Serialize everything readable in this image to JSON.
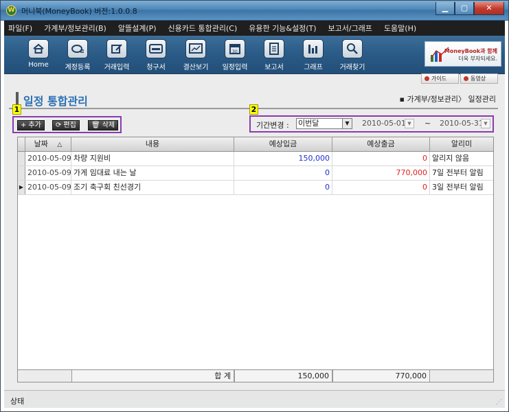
{
  "window": {
    "title": "머니북(MoneyBook) 버전:1.0.0.8",
    "app_icon_letter": "W",
    "controls": [
      "▁",
      "▢",
      "✕"
    ]
  },
  "menu": [
    "파일(F)",
    "가계부/정보관리(B)",
    "알뜰설계(P)",
    "신용카드 통합관리(C)",
    "유용한 기능&설정(T)",
    "보고서/그래프",
    "도움말(H)"
  ],
  "toolbar": [
    {
      "label": "Home",
      "icon": "home-icon"
    },
    {
      "label": "계정등록",
      "icon": "account-register-icon"
    },
    {
      "label": "거래입력",
      "icon": "transaction-edit-icon"
    },
    {
      "label": "청구서",
      "icon": "card-bill-icon"
    },
    {
      "label": "결산보기",
      "icon": "settlement-icon"
    },
    {
      "label": "일정입력",
      "icon": "calendar-icon"
    },
    {
      "label": "보고서",
      "icon": "report-icon"
    },
    {
      "label": "그래프",
      "icon": "bar-chart-icon"
    },
    {
      "label": "거래찾기",
      "icon": "search-icon"
    }
  ],
  "promo": {
    "line1": "MoneyBook과 함께",
    "line2": "더욱 부자되세요."
  },
  "help_buttons": {
    "guide": "가이드",
    "video": "동영상"
  },
  "page": {
    "title": "일정 통합관리",
    "breadcrumb": "▪ 가계부/정보관리〉 일정관리"
  },
  "markers": {
    "one": "1",
    "two": "2"
  },
  "actions": {
    "add": "추가",
    "edit": "편집",
    "delete": "삭제"
  },
  "period": {
    "label": "기간변경 :",
    "selected": "이번달",
    "start": "2010-05-01",
    "tilde": "~",
    "end": "2010-05-31"
  },
  "grid": {
    "columns": [
      "날짜",
      "내용",
      "예상입금",
      "예상출금",
      "알리미"
    ],
    "sort_indicator": "△",
    "rows": [
      {
        "date": "2010-05-09",
        "content": "차량 지원비",
        "income": "150,000",
        "expense": "0",
        "alarm": "알리지 않음"
      },
      {
        "date": "2010-05-09",
        "content": "가게 임대료 내는 날",
        "income": "0",
        "expense": "770,000",
        "alarm": "7일 전부터 알림"
      },
      {
        "date": "2010-05-09",
        "content": "조기 축구회 친선경기",
        "income": "0",
        "expense": "0",
        "alarm": "3일 전부터 알림"
      }
    ],
    "totals": {
      "label": "합 계",
      "income": "150,000",
      "expense": "770,000"
    }
  },
  "status": {
    "text": "상태"
  }
}
